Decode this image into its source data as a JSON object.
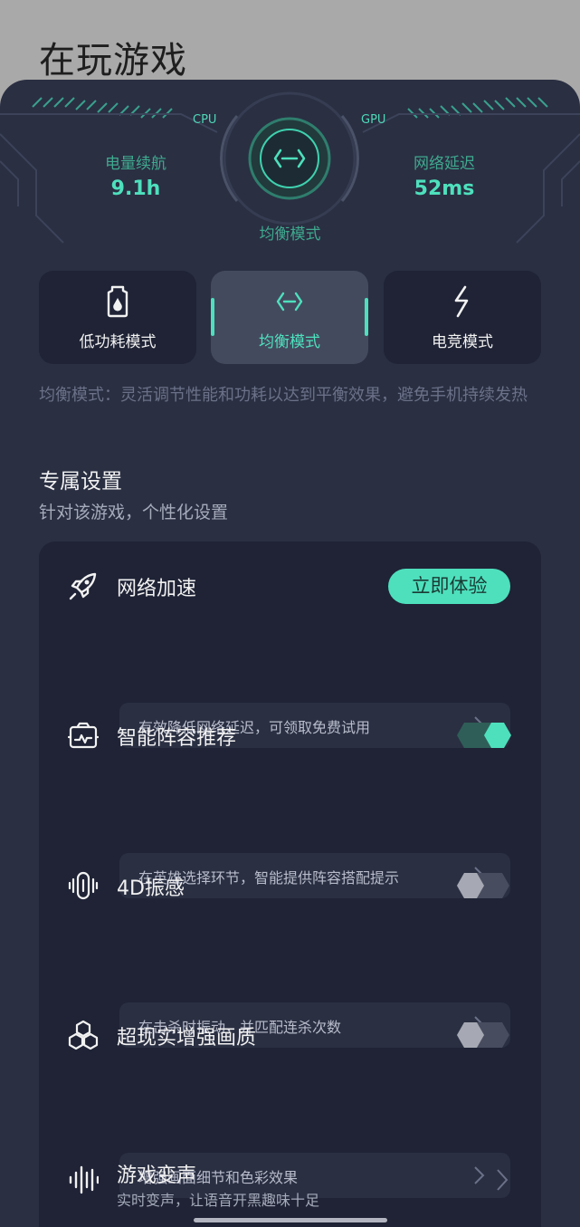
{
  "page_title": "在玩游戏",
  "header": {
    "cpu_label": "CPU",
    "gpu_label": "GPU",
    "battery": {
      "label": "电量续航",
      "value": "9.1h"
    },
    "latency": {
      "label": "网络延迟",
      "value": "52ms"
    },
    "current_mode": "均衡模式",
    "accent_color": "#4ee0bd"
  },
  "modes": [
    {
      "label": "低功耗模式",
      "icon": "battery-drop-icon",
      "active": false
    },
    {
      "label": "均衡模式",
      "icon": "balance-code-icon",
      "active": true
    },
    {
      "label": "电竞模式",
      "icon": "lightning-icon",
      "active": false
    }
  ],
  "mode_description": "均衡模式：灵活调节性能和功耗以达到平衡效果，避免手机持续发热",
  "section": {
    "title": "专属设置",
    "subtitle": "针对该游戏，个性化设置"
  },
  "settings": {
    "network": {
      "name": "网络加速",
      "icon": "rocket-icon",
      "action": "立即体验",
      "detail": "有效降低网络延迟，可领取免费试用"
    },
    "lineup": {
      "name": "智能阵容推荐",
      "icon": "monitor-pulse-icon",
      "toggle_on": true,
      "detail": "在英雄选择环节，智能提供阵容搭配提示"
    },
    "vibration": {
      "name": "4D振感",
      "icon": "vibration-icon",
      "toggle_on": false,
      "detail": "在击杀时振动，并匹配连杀次数"
    },
    "quality": {
      "name": "超现实增强画质",
      "icon": "hexagons-icon",
      "toggle_on": false,
      "detail": "增强画面细节和色彩效果"
    },
    "voice": {
      "name": "游戏变声",
      "icon": "soundwave-icon",
      "subtitle": "实时变声，让语音开黑趣味十足"
    }
  }
}
